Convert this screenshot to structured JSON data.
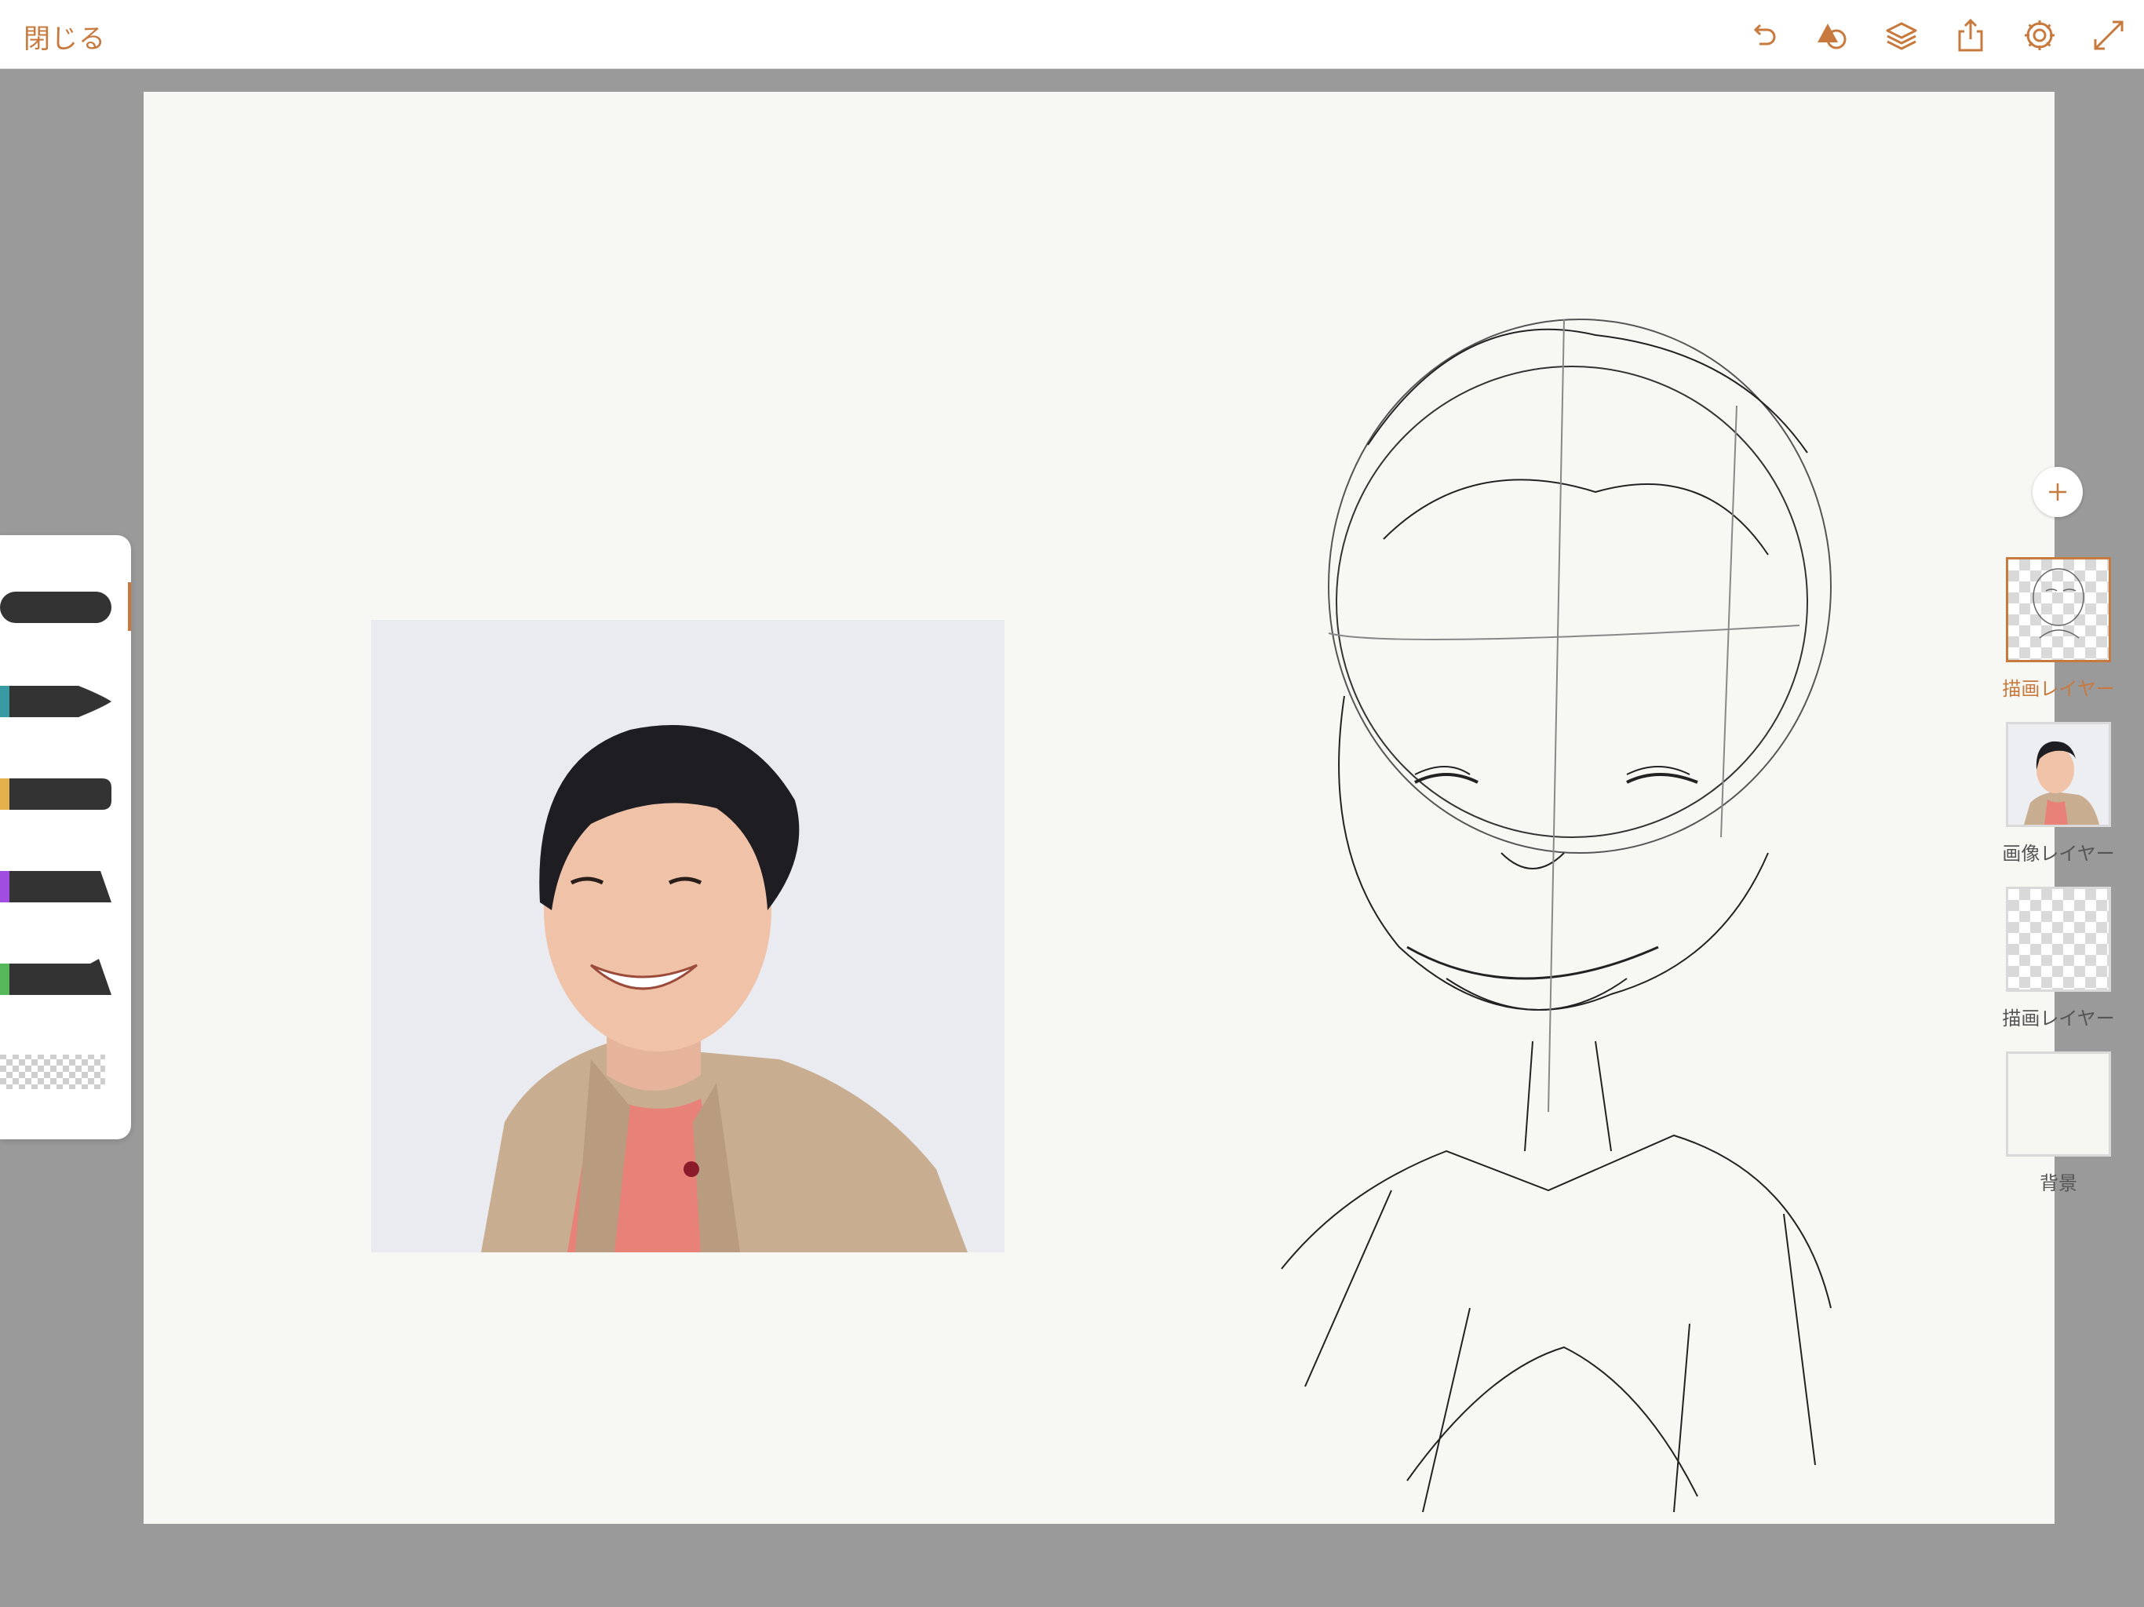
{
  "topbar": {
    "close_label": "閉じる",
    "icons": [
      "undo-icon",
      "shapes-icon",
      "layers-icon",
      "share-icon",
      "settings-icon",
      "fullscreen-icon"
    ],
    "accent_color": "#c8793d"
  },
  "brushes": [
    {
      "name": "marker",
      "accent": "#333333",
      "selected": true
    },
    {
      "name": "brush-pen",
      "accent": "#3a9aa3"
    },
    {
      "name": "pencil",
      "accent": "#e2b04d"
    },
    {
      "name": "fude",
      "accent": "#a24de2"
    },
    {
      "name": "ink-pen",
      "accent": "#55b85a"
    },
    {
      "name": "eraser",
      "accent": "#cccccc"
    }
  ],
  "layers": [
    {
      "label": "描画レイヤー",
      "active": true
    },
    {
      "label": "画像レイヤー",
      "active": false
    },
    {
      "label": "描画レイヤー",
      "active": false
    },
    {
      "label": "背景",
      "active": false
    }
  ]
}
